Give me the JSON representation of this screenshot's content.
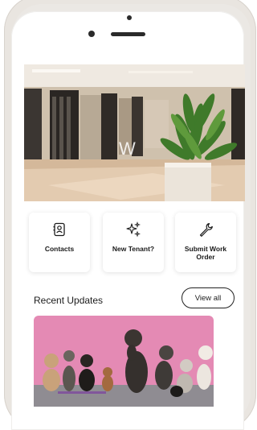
{
  "quick_actions": [
    {
      "label": "Contacts",
      "icon": "contacts-icon"
    },
    {
      "label": "New Tenant?",
      "icon": "sparkles-icon"
    },
    {
      "label": "Submit Work Order",
      "icon": "wrench-icon"
    }
  ],
  "recent_updates": {
    "title": "Recent Updates",
    "view_all_label": "View all"
  },
  "colors": {
    "hero_marble": "#d9c9b4",
    "card_wall": "#e58ab3",
    "tile_shadow": "#d0d0d0"
  }
}
